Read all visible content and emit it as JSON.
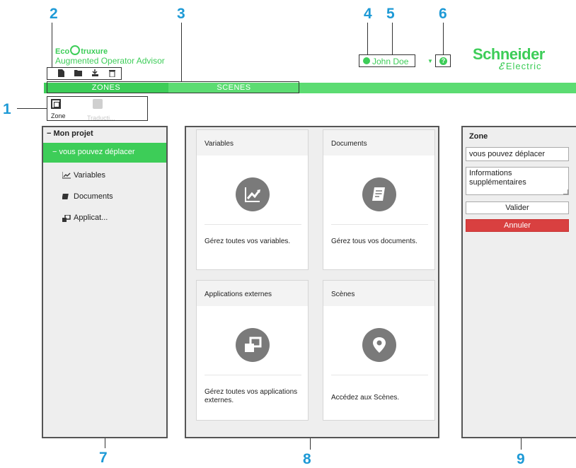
{
  "callouts": [
    "1",
    "2",
    "3",
    "4",
    "5",
    "6",
    "7",
    "8",
    "9"
  ],
  "header": {
    "brand_prefix": "Eco",
    "brand_suffix": "truxure",
    "app_title": "Augmented Operator Advisor",
    "user_name": "John Doe",
    "dropdown_glyph": "▼",
    "help_glyph": "?",
    "vendor_name": "Schneider",
    "vendor_sub": "Electric"
  },
  "tabs": [
    {
      "label": "ZONES",
      "active": true
    },
    {
      "label": "SCENES",
      "active": false
    }
  ],
  "actions": [
    {
      "label": "Zone",
      "enabled": true
    },
    {
      "label": "Traducti...",
      "enabled": false
    }
  ],
  "tree": {
    "root": "Mon projet",
    "selected": "vous pouvez déplacer",
    "children": [
      {
        "label": "Variables",
        "icon": "chart-icon"
      },
      {
        "label": "Documents",
        "icon": "book-icon"
      },
      {
        "label": "Applicat...",
        "icon": "windows-icon"
      }
    ]
  },
  "cards": [
    {
      "title": "Variables",
      "icon": "chart-icon",
      "description": "Gérez toutes vos variables."
    },
    {
      "title": "Documents",
      "icon": "book-icon",
      "description": "Gérez tous vos documents."
    },
    {
      "title": "Applications externes",
      "icon": "windows-icon",
      "description": "Gérez toutes vos applications externes."
    },
    {
      "title": "Scènes",
      "icon": "location-pin-icon",
      "description": "Accédez aux Scènes."
    }
  ],
  "properties": {
    "title": "Zone",
    "name_value": "vous pouvez déplacer",
    "info_value": "Informations supplémentaires",
    "validate_label": "Valider",
    "cancel_label": "Annuler"
  },
  "colors": {
    "accent": "#3dcd58",
    "callout": "#1e9ad6",
    "cancel": "#d94040"
  }
}
